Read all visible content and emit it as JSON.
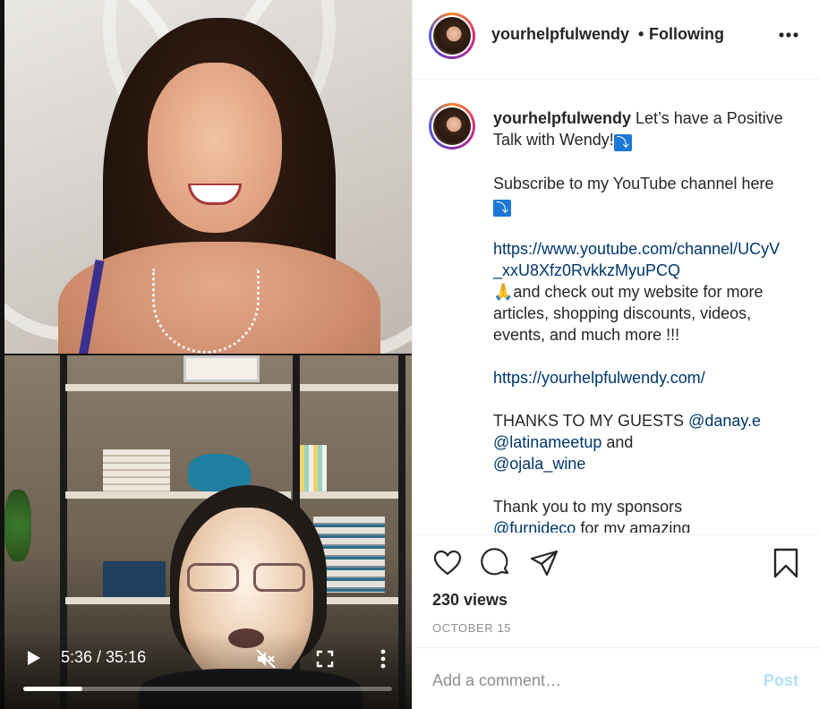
{
  "video": {
    "time_display": "5:36 / 35:16",
    "progress_fraction": 0.159,
    "icons": {
      "play": "play-icon",
      "mute": "muted-speaker-icon",
      "fullscreen": "fullscreen-icon",
      "more": "more-vertical-icon"
    }
  },
  "header": {
    "username": "yourhelpfulwendy",
    "separator": "•",
    "follow_status": "Following"
  },
  "caption": {
    "username": "yourhelpfulwendy",
    "line1": " Let’s have a Positive Talk with Wendy!",
    "arrow_emoji": "⤵",
    "line2": "Subscribe to my YouTube channel here",
    "youtube_link": "https://www.youtube.com/channel/UCyV_xxU8Xfz0RvkkzMyuPCQ",
    "pray_emoji": "🙏",
    "line3": "and check out my website for more articles, shopping discounts, videos, events, and much more !!!",
    "website_link": "https://yourhelpfulwendy.com/",
    "guests_prefix": "THANKS TO MY GUESTS ",
    "guest1": "@danay.e",
    "guest2": "@latinameetup",
    "and_text": " and",
    "guest3": "@ojala_wine",
    "sponsors_prefix": "Thank you to my sponsors",
    "sponsor1": "@furnideco",
    "sponsors_suffix": " for my amazing"
  },
  "actions": {
    "views": "230 views",
    "date": "OCTOBER 15"
  },
  "comment": {
    "placeholder": "Add a comment…",
    "post_label": "Post",
    "post_color": "#b2dffc"
  }
}
